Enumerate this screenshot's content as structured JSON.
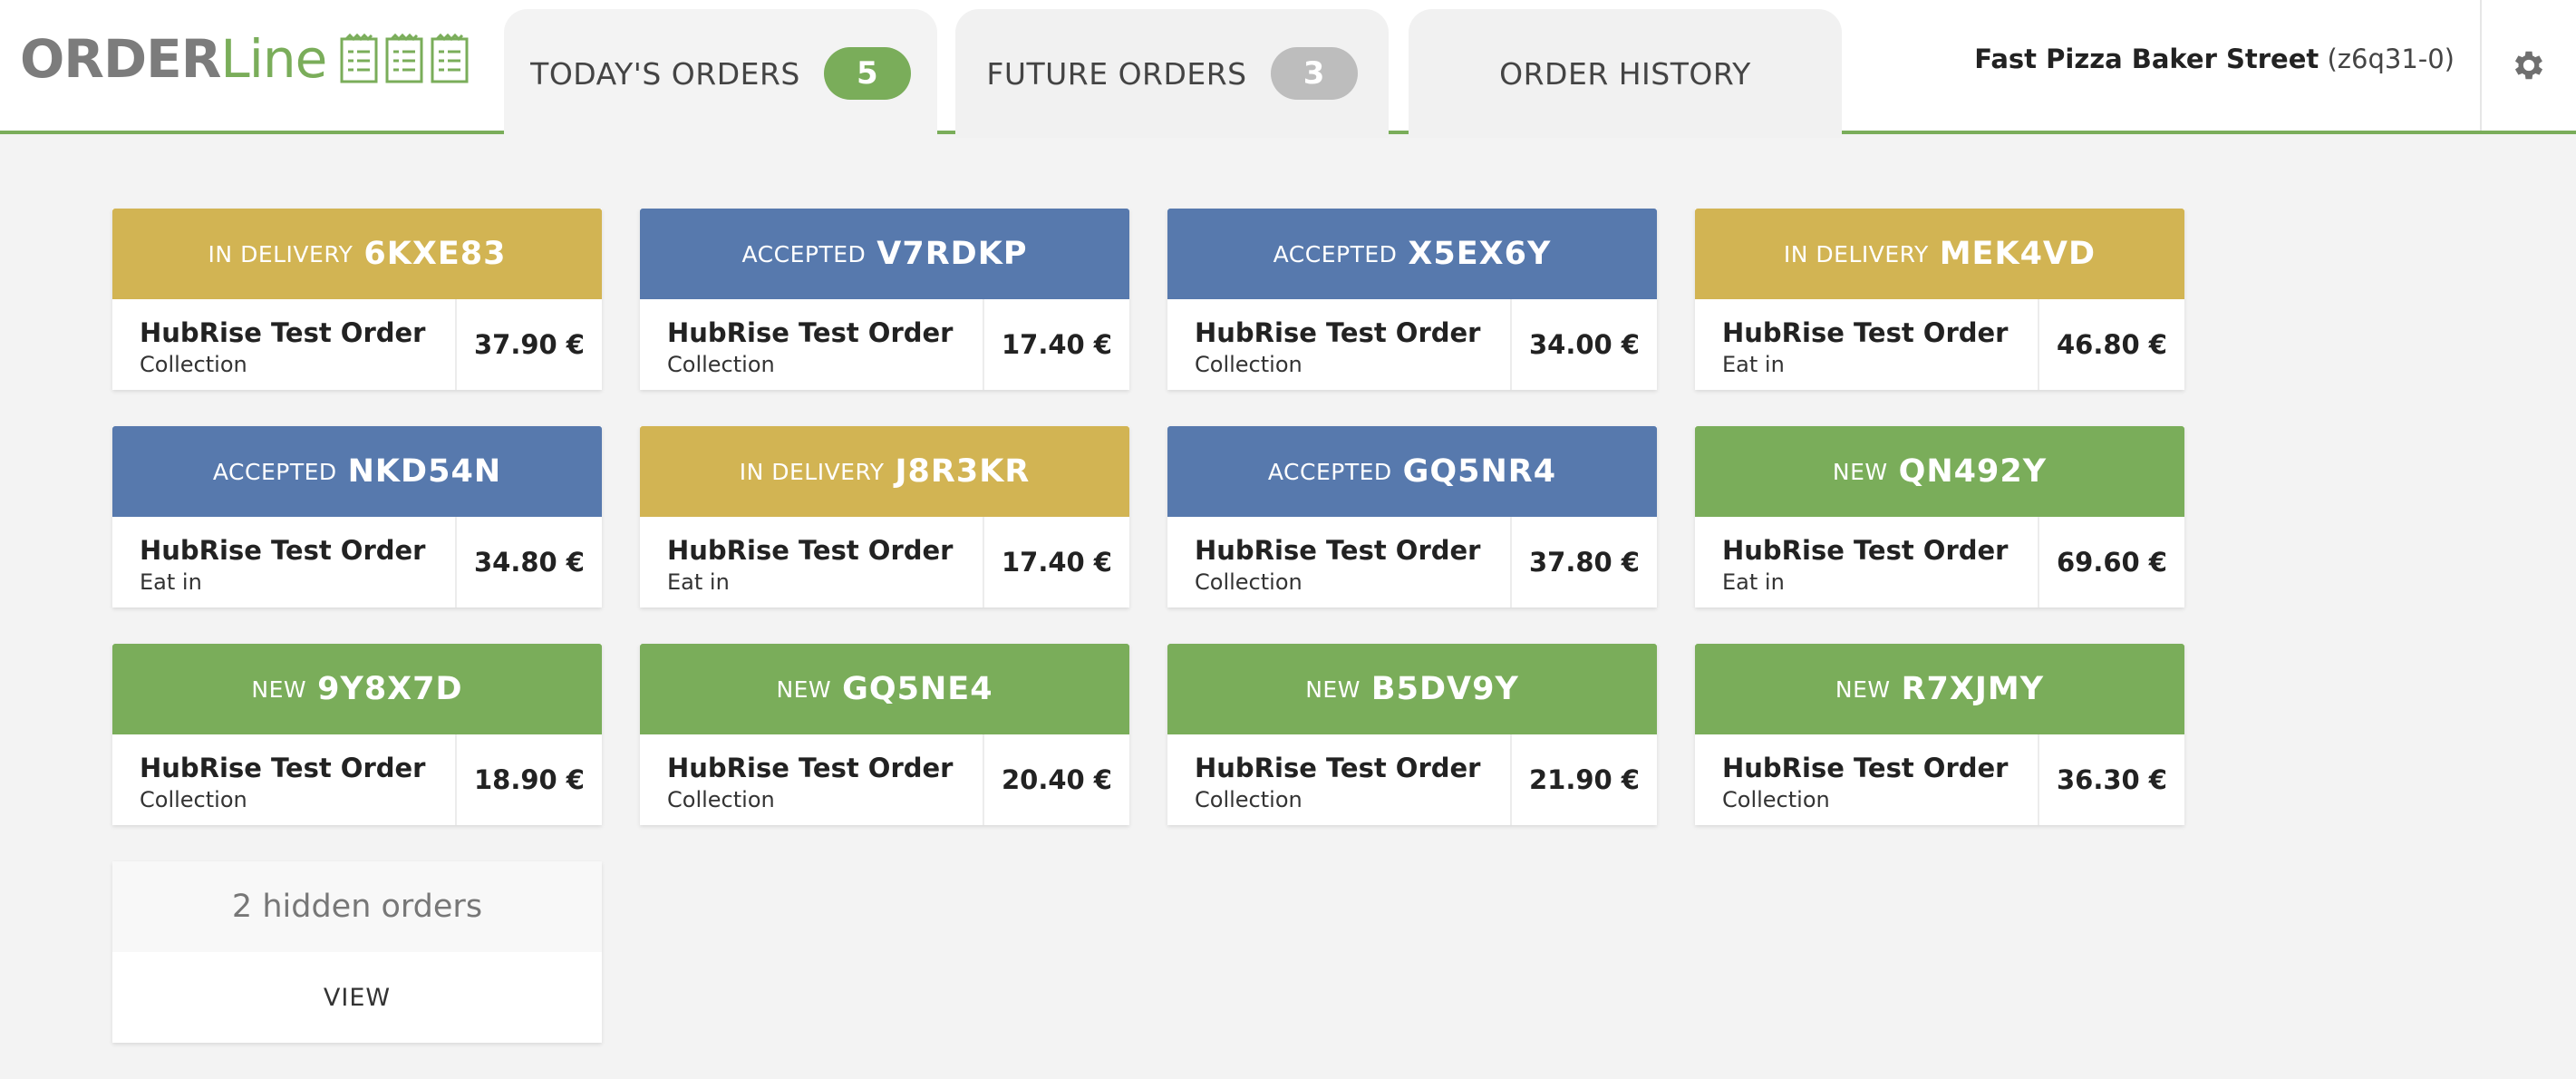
{
  "app": {
    "logo_part1": "ORDER",
    "logo_part2": "Line"
  },
  "tabs": [
    {
      "label": "TODAY'S ORDERS",
      "count": "5",
      "active": true
    },
    {
      "label": "FUTURE ORDERS",
      "count": "3",
      "active": false
    },
    {
      "label": "ORDER HISTORY",
      "count": null,
      "active": false
    }
  ],
  "store": {
    "name": "Fast Pizza Baker Street",
    "code": "(z6q31-0)"
  },
  "colors": {
    "accent_green": "#7aad5a",
    "status_in_delivery": "#d2b453",
    "status_accepted": "#5779ad",
    "status_new": "#7aad5a"
  },
  "orders": [
    {
      "status": "IN DELIVERY",
      "code": "6KXE83",
      "title": "HubRise Test Order",
      "type": "Collection",
      "price": "37.90 €"
    },
    {
      "status": "ACCEPTED",
      "code": "V7RDKP",
      "title": "HubRise Test Order",
      "type": "Collection",
      "price": "17.40 €"
    },
    {
      "status": "ACCEPTED",
      "code": "X5EX6Y",
      "title": "HubRise Test Order",
      "type": "Collection",
      "price": "34.00 €"
    },
    {
      "status": "IN DELIVERY",
      "code": "MEK4VD",
      "title": "HubRise Test Order",
      "type": "Eat in",
      "price": "46.80 €"
    },
    {
      "status": "ACCEPTED",
      "code": "NKD54N",
      "title": "HubRise Test Order",
      "type": "Eat in",
      "price": "34.80 €"
    },
    {
      "status": "IN DELIVERY",
      "code": "J8R3KR",
      "title": "HubRise Test Order",
      "type": "Eat in",
      "price": "17.40 €"
    },
    {
      "status": "ACCEPTED",
      "code": "GQ5NR4",
      "title": "HubRise Test Order",
      "type": "Collection",
      "price": "37.80 €"
    },
    {
      "status": "NEW",
      "code": "QN492Y",
      "title": "HubRise Test Order",
      "type": "Eat in",
      "price": "69.60 €"
    },
    {
      "status": "NEW",
      "code": "9Y8X7D",
      "title": "HubRise Test Order",
      "type": "Collection",
      "price": "18.90 €"
    },
    {
      "status": "NEW",
      "code": "GQ5NE4",
      "title": "HubRise Test Order",
      "type": "Collection",
      "price": "20.40 €"
    },
    {
      "status": "NEW",
      "code": "B5DV9Y",
      "title": "HubRise Test Order",
      "type": "Collection",
      "price": "21.90 €"
    },
    {
      "status": "NEW",
      "code": "R7XJMY",
      "title": "HubRise Test Order",
      "type": "Collection",
      "price": "36.30 €"
    }
  ],
  "hidden": {
    "text": "2 hidden orders",
    "view_label": "VIEW"
  }
}
